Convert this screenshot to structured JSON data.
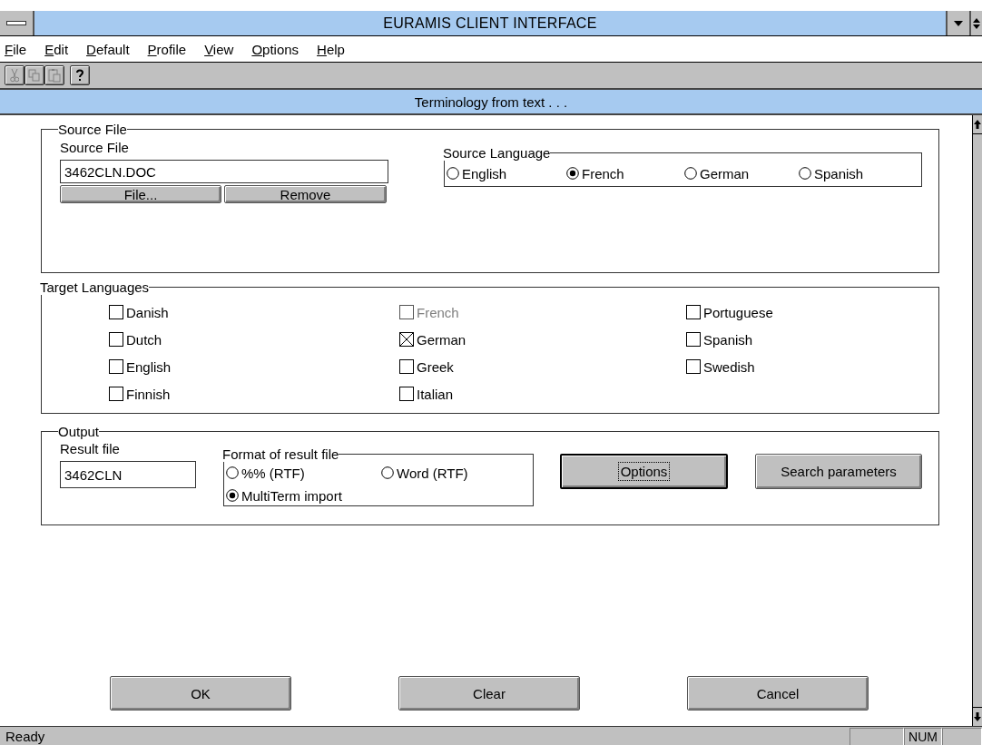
{
  "window": {
    "title": "EURAMIS CLIENT INTERFACE"
  },
  "menu": [
    "File",
    "Edit",
    "Default",
    "Profile",
    "View",
    "Options",
    "Help"
  ],
  "toolbar": [
    {
      "kind": "cut",
      "disabled": true
    },
    {
      "kind": "copy",
      "disabled": true
    },
    {
      "kind": "paste",
      "disabled": true
    },
    {
      "kind": "help",
      "disabled": false
    }
  ],
  "subtitle": "Terminology from text . . .",
  "source_file": {
    "title": "Source File",
    "label": "Source File",
    "value": "3462CLN.DOC",
    "buttons": [
      "File...",
      "Remove"
    ]
  },
  "source_language": {
    "title": "Source Language",
    "options": [
      {
        "label": "English",
        "selected": false
      },
      {
        "label": "French",
        "selected": true
      },
      {
        "label": "German",
        "selected": false
      },
      {
        "label": "Spanish",
        "selected": false
      }
    ]
  },
  "target_languages": {
    "title": "Target Languages",
    "items": [
      {
        "label": "Danish",
        "checked": false,
        "disabled": false
      },
      {
        "label": "Dutch",
        "checked": false,
        "disabled": false
      },
      {
        "label": "English",
        "checked": false,
        "disabled": false
      },
      {
        "label": "Finnish",
        "checked": false,
        "disabled": false
      },
      {
        "label": "French",
        "checked": false,
        "disabled": true
      },
      {
        "label": "German",
        "checked": true,
        "disabled": false
      },
      {
        "label": "Greek",
        "checked": false,
        "disabled": false
      },
      {
        "label": "Italian",
        "checked": false,
        "disabled": false
      },
      {
        "label": "Portuguese",
        "checked": false,
        "disabled": false
      },
      {
        "label": "Spanish",
        "checked": false,
        "disabled": false
      },
      {
        "label": "Swedish",
        "checked": false,
        "disabled": false
      }
    ]
  },
  "output": {
    "title": "Output",
    "result_label": "Result file",
    "result_value": "3462CLN",
    "format": {
      "title": "Format of result file",
      "options": [
        {
          "label": "%% (RTF)",
          "selected": false
        },
        {
          "label": "Word (RTF)",
          "selected": false
        },
        {
          "label": "MultiTerm import",
          "selected": true
        }
      ]
    },
    "buttons": [
      {
        "label": "Options",
        "focused": true
      },
      {
        "label": "Search parameters",
        "focused": false
      }
    ]
  },
  "actions": [
    "OK",
    "Clear",
    "Cancel"
  ],
  "status_bar": {
    "text": "Ready",
    "indicators": [
      "NUM"
    ]
  }
}
